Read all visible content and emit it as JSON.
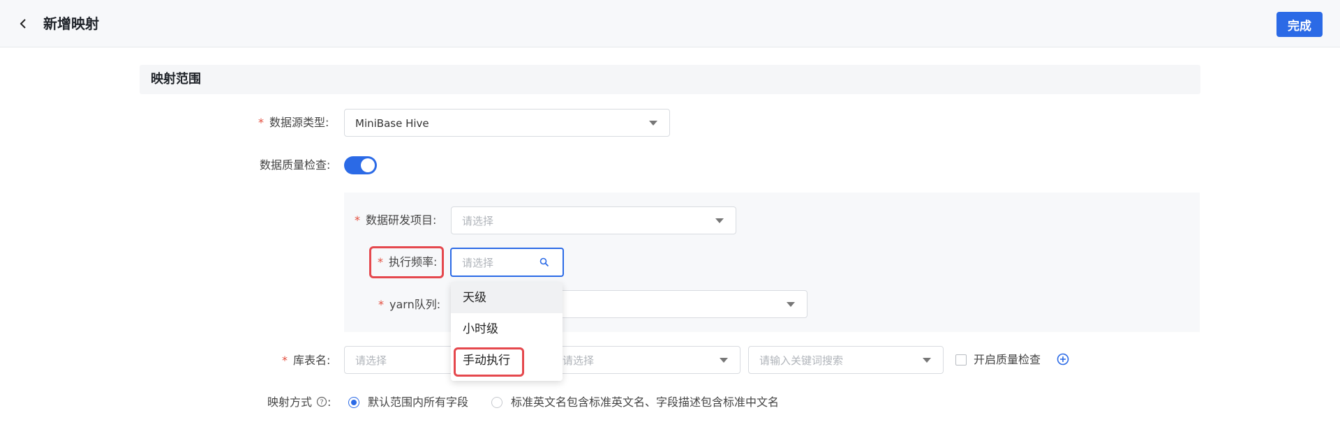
{
  "header": {
    "title": "新增映射",
    "done_label": "完成"
  },
  "section": {
    "title": "映射范围"
  },
  "form": {
    "datasource_type": {
      "label": "数据源类型:",
      "value": "MiniBase Hive"
    },
    "quality_check": {
      "label": "数据质量检查:",
      "enabled": true
    },
    "dev_project": {
      "label": "数据研发项目:",
      "placeholder": "请选择"
    },
    "exec_frequency": {
      "label": "执行频率:",
      "placeholder": "请选择",
      "options": [
        "天级",
        "小时级",
        "手动执行"
      ],
      "hovered_option": "天级",
      "highlighted_option": "手动执行"
    },
    "yarn_queue": {
      "label": "yarn队列:"
    },
    "table_name": {
      "label": "库表名:",
      "db_placeholder": "请选择",
      "table_placeholder": "请选择",
      "keyword_placeholder": "请输入关键词搜索",
      "quality_check_label": "开启质量检查"
    },
    "mapping_mode": {
      "label": "映射方式",
      "options": [
        "默认范围内所有字段",
        "标准英文名包含标准英文名、字段描述包含标准中文名"
      ],
      "selected_index": 0
    }
  },
  "colors": {
    "primary": "#2b6ae6",
    "required": "#e34d3d",
    "highlight_box": "#e5484d"
  }
}
